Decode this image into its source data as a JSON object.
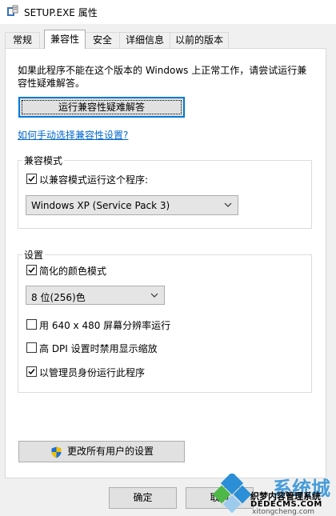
{
  "window": {
    "title": "SETUP.EXE 属性",
    "icon": "setup-program-icon"
  },
  "tabs": [
    {
      "label": "常规",
      "active": false
    },
    {
      "label": "兼容性",
      "active": true
    },
    {
      "label": "安全",
      "active": false
    },
    {
      "label": "详细信息",
      "active": false
    },
    {
      "label": "以前的版本",
      "active": false
    }
  ],
  "compat_page": {
    "description": "如果此程序不能在这个版本的 Windows 上正常工作，请尝试运行兼容性疑难解答。",
    "troubleshooter_button": "运行兼容性疑难解答",
    "manual_link": "如何手动选择兼容性设置?"
  },
  "compat_mode": {
    "group_title": "兼容模式",
    "run_in_compat_label": "以兼容模式运行这个程序:",
    "run_in_compat_checked": true,
    "os_select_value": "Windows XP (Service Pack 3)"
  },
  "settings": {
    "group_title": "设置",
    "reduced_color_label": "简化的颜色模式",
    "reduced_color_checked": true,
    "color_select_value": "8 位(256)色",
    "res_640_label": "用 640 x 480 屏幕分辨率运行",
    "res_640_checked": false,
    "high_dpi_label": "高 DPI 设置时禁用显示缩放",
    "high_dpi_checked": false,
    "run_as_admin_label": "以管理员身份运行此程序",
    "run_as_admin_checked": true
  },
  "change_all_users_button": "更改所有用户的设置",
  "dialog_buttons": {
    "ok": "确定",
    "cancel": "取消"
  },
  "watermark": {
    "brand": "系统城",
    "site_name": "织梦内容管理系统",
    "site_url": "DEDECMS.COM",
    "sub_url": "xitongcheng.com",
    "color_primary": "#2a8fd6",
    "color_accent": "#4db848"
  }
}
